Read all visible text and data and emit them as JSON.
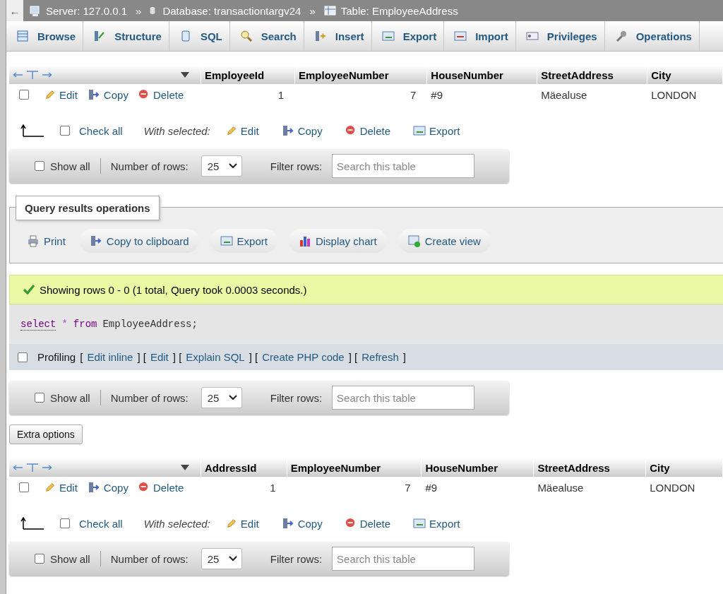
{
  "breadcrumb": {
    "back": "←",
    "items": [
      {
        "label": "Server: 127.0.0.1",
        "kind": "server"
      },
      {
        "label": "Database: transactiontargv24",
        "kind": "database",
        "separator": "»"
      },
      {
        "label": "Table: EmployeeAddress",
        "kind": "table",
        "separator": "»"
      }
    ]
  },
  "tabs": [
    {
      "label": "Browse",
      "kind": "browse",
      "selected": false
    },
    {
      "label": "Structure",
      "kind": "structure",
      "selected": false
    },
    {
      "label": "SQL",
      "kind": "sql",
      "selected": false
    },
    {
      "label": "Search",
      "kind": "search",
      "selected": false
    },
    {
      "label": "Insert",
      "kind": "insert",
      "selected": false
    },
    {
      "label": "Export",
      "kind": "export",
      "selected": false
    },
    {
      "label": "Import",
      "kind": "import",
      "selected": false
    },
    {
      "label": "Privileges",
      "kind": "privileges",
      "selected": false
    },
    {
      "label": "Operations",
      "kind": "operations",
      "selected": false
    }
  ],
  "results_top": {
    "columns": [
      {
        "label": "EmployeeId",
        "kind": "number"
      },
      {
        "label": "EmployeeNumber",
        "kind": "number"
      },
      {
        "label": "HouseNumber",
        "kind": "text"
      },
      {
        "label": "StreetAddress",
        "kind": "text"
      },
      {
        "label": "City",
        "kind": "text"
      }
    ],
    "rows": [
      {
        "checked": false,
        "actions": [
          {
            "label": "Edit",
            "kind": "edit"
          },
          {
            "label": "Copy",
            "kind": "copy"
          },
          {
            "label": "Delete",
            "kind": "delete"
          }
        ],
        "cells": [
          "1",
          "7",
          "#9",
          "Mäealuse",
          "LONDON"
        ]
      }
    ],
    "bulk": {
      "check_all": "Check all",
      "checked": false,
      "with_selected": "With selected:",
      "actions": [
        {
          "label": "Edit",
          "kind": "edit"
        },
        {
          "label": "Copy",
          "kind": "copy"
        },
        {
          "label": "Delete",
          "kind": "delete"
        },
        {
          "label": "Export",
          "kind": "export"
        }
      ]
    },
    "nav": {
      "show_all": "Show all",
      "show_all_checked": false,
      "rows_label": "Number of rows:",
      "rows_value": "25",
      "filter_label": "Filter rows:",
      "filter_placeholder": "Search this table"
    }
  },
  "query_ops": {
    "title": "Query results operations",
    "buttons": [
      {
        "label": "Print",
        "kind": "print"
      },
      {
        "label": "Copy to clipboard",
        "kind": "copy"
      },
      {
        "label": "Export",
        "kind": "export"
      },
      {
        "label": "Display chart",
        "kind": "chart"
      },
      {
        "label": "Create view",
        "kind": "view"
      }
    ]
  },
  "message": "Showing rows 0 - 0 (1 total, Query took 0.0003 seconds.)",
  "sql": [
    {
      "text": "select",
      "kind": "keyword-link"
    },
    {
      "text": "*",
      "kind": "operator"
    },
    {
      "text": "from",
      "kind": "keyword"
    },
    {
      "text": "EmployeeAddress;",
      "kind": "plain"
    }
  ],
  "profiling": {
    "checked": false,
    "label": "Profiling",
    "parts": [
      {
        "text": "[",
        "kind": "text"
      },
      {
        "text": "Edit inline",
        "kind": "link"
      },
      {
        "text": "] [",
        "kind": "text"
      },
      {
        "text": "Edit",
        "kind": "link"
      },
      {
        "text": "] [",
        "kind": "text"
      },
      {
        "text": "Explain SQL",
        "kind": "link"
      },
      {
        "text": "] [",
        "kind": "text"
      },
      {
        "text": "Create PHP code",
        "kind": "link"
      },
      {
        "text": "] [",
        "kind": "text"
      },
      {
        "text": "Refresh",
        "kind": "link"
      },
      {
        "text": "]",
        "kind": "text"
      }
    ]
  },
  "nav_middle": {
    "show_all": "Show all",
    "show_all_checked": false,
    "rows_label": "Number of rows:",
    "rows_value": "25",
    "filter_label": "Filter rows:",
    "filter_placeholder": "Search this table"
  },
  "extra_options": "Extra options",
  "results_bottom": {
    "columns": [
      {
        "label": "AddressId",
        "kind": "number"
      },
      {
        "label": "EmployeeNumber",
        "kind": "number"
      },
      {
        "label": "HouseNumber",
        "kind": "text"
      },
      {
        "label": "StreetAddress",
        "kind": "text"
      },
      {
        "label": "City",
        "kind": "text"
      }
    ],
    "rows": [
      {
        "checked": false,
        "actions": [
          {
            "label": "Edit",
            "kind": "edit"
          },
          {
            "label": "Copy",
            "kind": "copy"
          },
          {
            "label": "Delete",
            "kind": "delete"
          }
        ],
        "cells": [
          "1",
          "7",
          "#9",
          "Mäealuse",
          "LONDON"
        ]
      }
    ],
    "bulk": {
      "check_all": "Check all",
      "checked": false,
      "with_selected": "With selected:",
      "actions": [
        {
          "label": "Edit",
          "kind": "edit"
        },
        {
          "label": "Copy",
          "kind": "copy"
        },
        {
          "label": "Delete",
          "kind": "delete"
        },
        {
          "label": "Export",
          "kind": "export"
        }
      ]
    },
    "nav": {
      "show_all": "Show all",
      "show_all_checked": false,
      "rows_label": "Number of rows:",
      "rows_value": "25",
      "filter_label": "Filter rows:",
      "filter_placeholder": "Search this table"
    }
  }
}
